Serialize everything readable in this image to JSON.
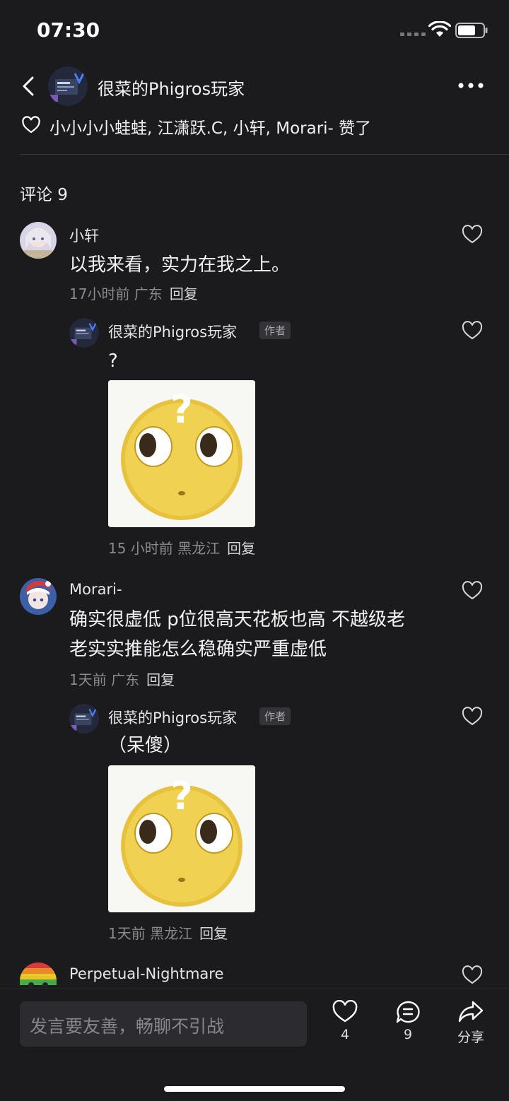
{
  "status_bar": {
    "time": "07:30"
  },
  "header": {
    "author_name": "很菜的Phigros玩家"
  },
  "likers": {
    "text": "小小小小蛙蛙, 江潇跃.C, 小轩, Morari- 赞了"
  },
  "comments_section": {
    "title": "评论 9"
  },
  "comments": [
    {
      "user": "小轩",
      "text": "以我来看，实力在我之上。",
      "meta": "17小时前 广东",
      "reply_label": "回复"
    },
    {
      "user": "很菜的Phigros玩家",
      "badge": "作者",
      "text": "?",
      "meta": "15 小时前 黑龙江",
      "reply_label": "回复"
    },
    {
      "user": "Morari-",
      "text_line1": "确实很虚低 p位很高天花板也高 不越级老",
      "text_line2": "老实实推能怎么稳确实严重虚低",
      "meta": "1天前 广东",
      "reply_label": "回复"
    },
    {
      "user": "很菜的Phigros玩家",
      "badge": "作者",
      "text": "（呆傻）",
      "meta": "1天前 黑龙江",
      "reply_label": "回复"
    },
    {
      "user": "Perpetual-Nightmare"
    }
  ],
  "bottom_bar": {
    "input_placeholder": "发言要友善，畅聊不引战",
    "like_count": "4",
    "comment_count": "9",
    "share_label": "分享"
  },
  "colors": {
    "background": "#1b1b1d",
    "input_bg": "#2c2c30",
    "text_secondary": "#8a8a8f"
  },
  "icons": [
    "back-icon",
    "more-icon",
    "heart-icon",
    "comment-icon",
    "share-icon",
    "wifi-icon",
    "battery-icon"
  ]
}
